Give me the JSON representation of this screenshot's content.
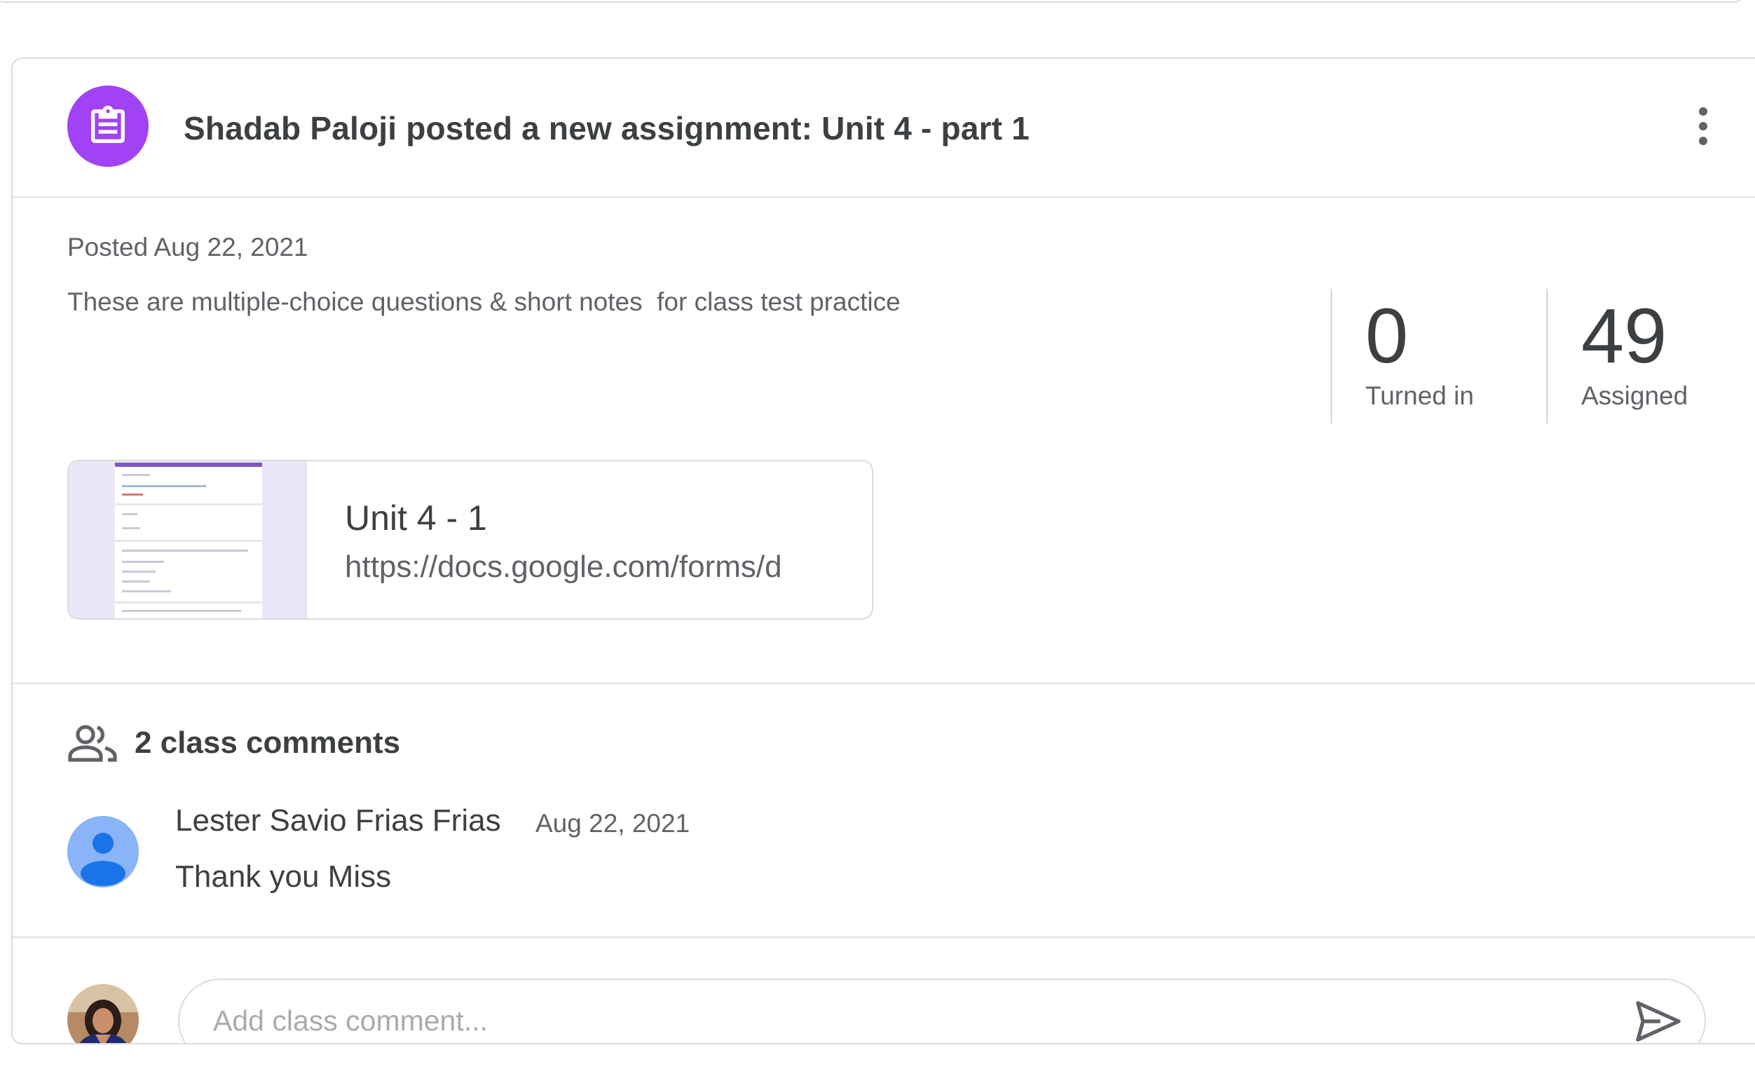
{
  "header": {
    "title": "Shadab Paloji posted a new assignment: Unit 4 - part 1",
    "assignment_icon": "assignment-icon",
    "more_icon": "more-vert-icon"
  },
  "post": {
    "posted": "Posted Aug 22, 2021",
    "description": "These are multiple-choice questions & short notes  for class test practice"
  },
  "stats": {
    "turned_in": {
      "value": "0",
      "label": "Turned in"
    },
    "assigned": {
      "value": "49",
      "label": "Assigned"
    }
  },
  "attachment": {
    "title": "Unit 4 - 1",
    "url": "https://docs.google.com/forms/d"
  },
  "comments": {
    "icon": "people-icon",
    "count_label": "2 class comments",
    "items": [
      {
        "author": "Lester Savio Frias Frias",
        "date": "Aug 22, 2021",
        "text": "Thank you Miss"
      }
    ]
  },
  "compose": {
    "placeholder": "Add class comment...",
    "send_icon": "send-icon"
  },
  "colors": {
    "assignment_accent": "#a142f4",
    "default_avatar": "#8ab4f8",
    "border": "#dadce0"
  }
}
